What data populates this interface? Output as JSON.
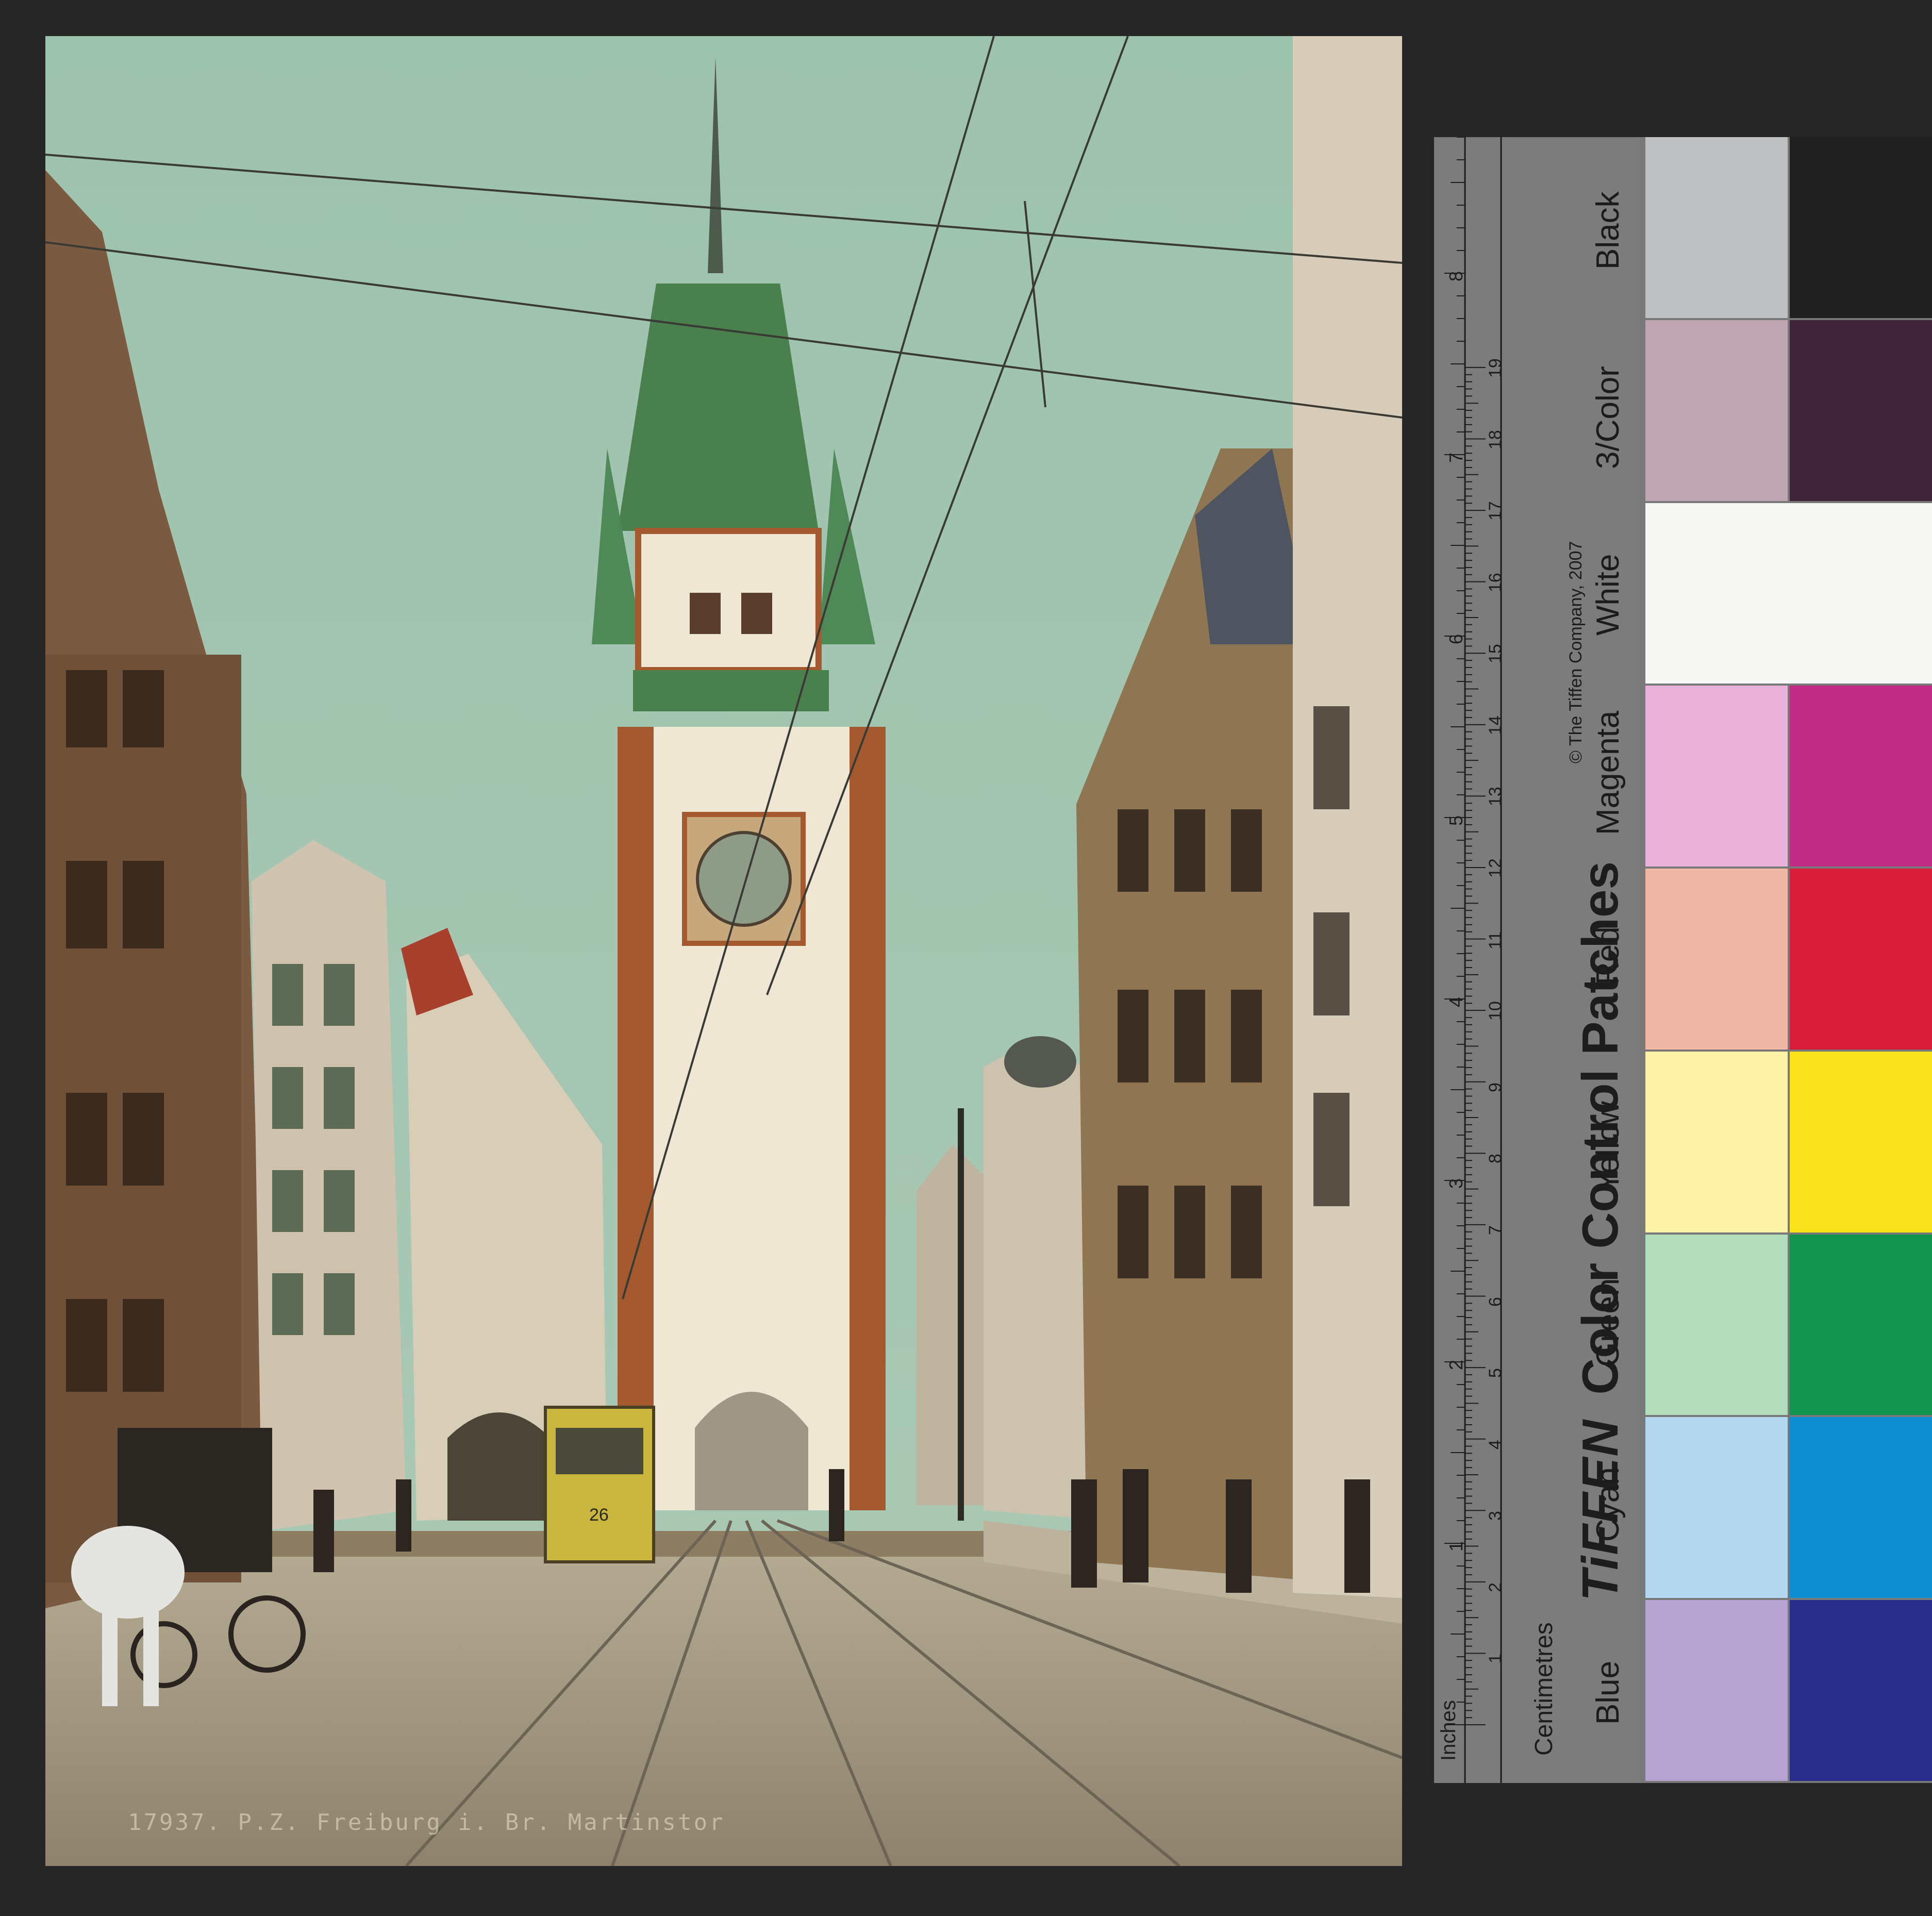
{
  "photo": {
    "caption": "17937. P.Z. Freiburg i. Br. Martinstor",
    "tram_number": "26"
  },
  "card": {
    "brand": "TiFFEN",
    "title": "Color Control Patches",
    "copyright": "© The Tiffen Company, 2007",
    "units_inches": "Inches",
    "units_cm": "Centimetres",
    "inch_marks": [
      "1",
      "2",
      "3",
      "4",
      "5",
      "6",
      "7",
      "8"
    ],
    "cm_marks": [
      "1",
      "2",
      "3",
      "4",
      "5",
      "6",
      "7",
      "8",
      "9",
      "10",
      "11",
      "12",
      "13",
      "14",
      "15",
      "16",
      "17",
      "18",
      "19"
    ],
    "patches": [
      {
        "label": "Blue",
        "light": "#b5a3d2",
        "dark": "#2a2d8a"
      },
      {
        "label": "Cyan",
        "light": "#b2d7ef",
        "dark": "#0d8fd1"
      },
      {
        "label": "Green",
        "light": "#b2dcbc",
        "dark": "#11944d"
      },
      {
        "label": "Yellow",
        "light": "#fbf2a8",
        "dark": "#f9e31b"
      },
      {
        "label": "Red",
        "light": "#f0b7a7",
        "dark": "#d81c3a"
      },
      {
        "label": "Magenta",
        "light": "#eab2d8",
        "dark": "#c02b84"
      },
      {
        "label": "White",
        "light": "#f7f7f5",
        "dark": "#f7f7f5"
      },
      {
        "label": "3/Color",
        "light": "#bda5b1",
        "dark": "#3e2537"
      },
      {
        "label": "Black",
        "light": "#bfc0c1",
        "dark": "#202021"
      }
    ]
  },
  "colors": {
    "sky": "#9fc4ae",
    "tower_roof": "#4a7f4e",
    "tower_stone": "#a5592f",
    "tower_plaster": "#efe6d3",
    "street": "#a99f88",
    "tram": "#c9b63f"
  }
}
